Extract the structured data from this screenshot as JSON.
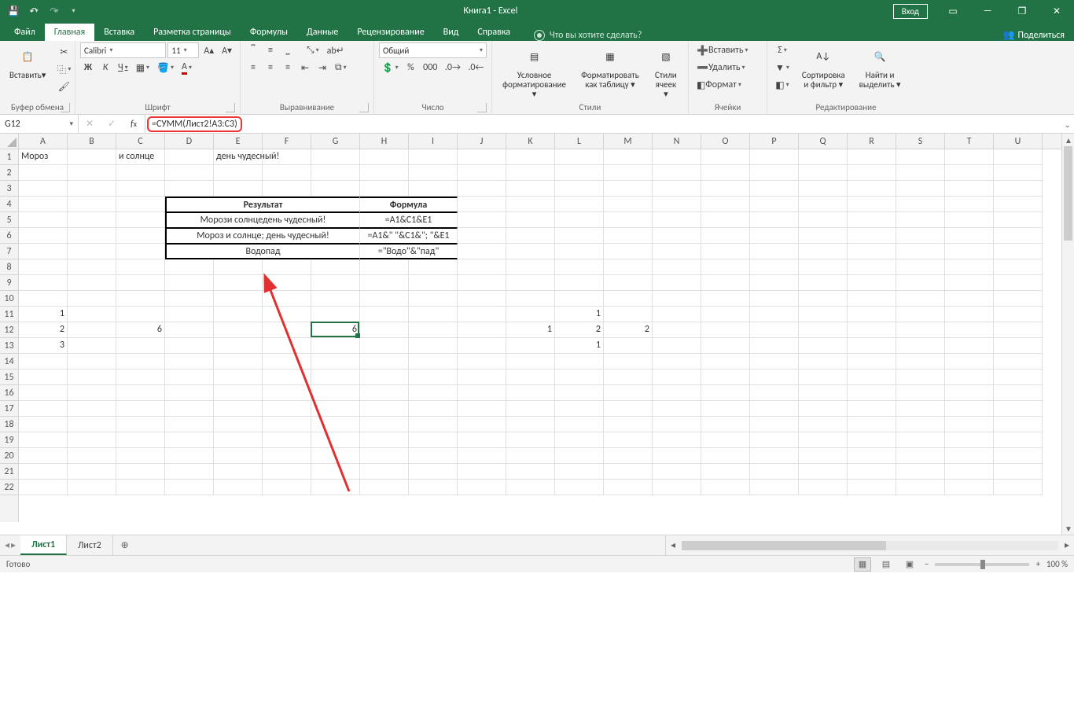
{
  "title": "Книга1  -  Excel",
  "login": "Вход",
  "tabs": [
    "Файл",
    "Главная",
    "Вставка",
    "Разметка страницы",
    "Формулы",
    "Данные",
    "Рецензирование",
    "Вид",
    "Справка"
  ],
  "active_tab": 1,
  "tell_me": "Что вы хотите сделать?",
  "share": "Поделиться",
  "groups": {
    "clipboard": {
      "paste": "Вставить",
      "label": "Буфер обмена"
    },
    "font": {
      "name": "Calibri",
      "size": "11",
      "label": "Шрифт",
      "bold": "Ж",
      "italic": "К",
      "underline": "Ч"
    },
    "align": {
      "label": "Выравнивание"
    },
    "number": {
      "format": "Общий",
      "label": "Число"
    },
    "styles": {
      "cond": "Условное",
      "cond2": "форматирование",
      "fmt": "Форматировать",
      "fmt2": "как таблицу",
      "cell": "Стили",
      "cell2": "ячеек",
      "label": "Стили"
    },
    "cells": {
      "insert": "Вставить",
      "delete": "Удалить",
      "format": "Формат",
      "label": "Ячейки"
    },
    "edit": {
      "sort": "Сортировка",
      "sort2": "и фильтр",
      "find": "Найти и",
      "find2": "выделить",
      "label": "Редактирование"
    }
  },
  "namebox": "G12",
  "formula": "=СУММ(Лист2!A3:C3)",
  "columns": [
    "A",
    "B",
    "C",
    "D",
    "E",
    "F",
    "G",
    "H",
    "I",
    "J",
    "K",
    "L",
    "M",
    "N",
    "O",
    "P",
    "Q",
    "R",
    "S",
    "T",
    "U"
  ],
  "rows": 22,
  "cellsData": {
    "A1": "Мороз",
    "C1": "и солнце",
    "E1": "день чудесный!",
    "D4": "Результат",
    "H4": "Формула",
    "D5": "Морози солнцедень чудесный!",
    "H5": "=A1&C1&E1",
    "D6": "Мороз и солнце; день чудесный!",
    "H6": "=A1&\" \"&C1&\"; \"&E1",
    "D7": "Водопад",
    "H7": "=\"Водо\"&\"пад\"",
    "A11": "1",
    "A12": "2",
    "A13": "3",
    "C12": "6",
    "G12": "6",
    "K12": "1",
    "L11": "1",
    "L12": "2",
    "L13": "1",
    "M12": "2"
  },
  "sel": {
    "col": 6,
    "row": 11
  },
  "sheets": [
    "Лист1",
    "Лист2"
  ],
  "active_sheet": 0,
  "status": "Готово",
  "zoom_minus": "−",
  "zoom_plus": "+",
  "zoom": "100 %"
}
